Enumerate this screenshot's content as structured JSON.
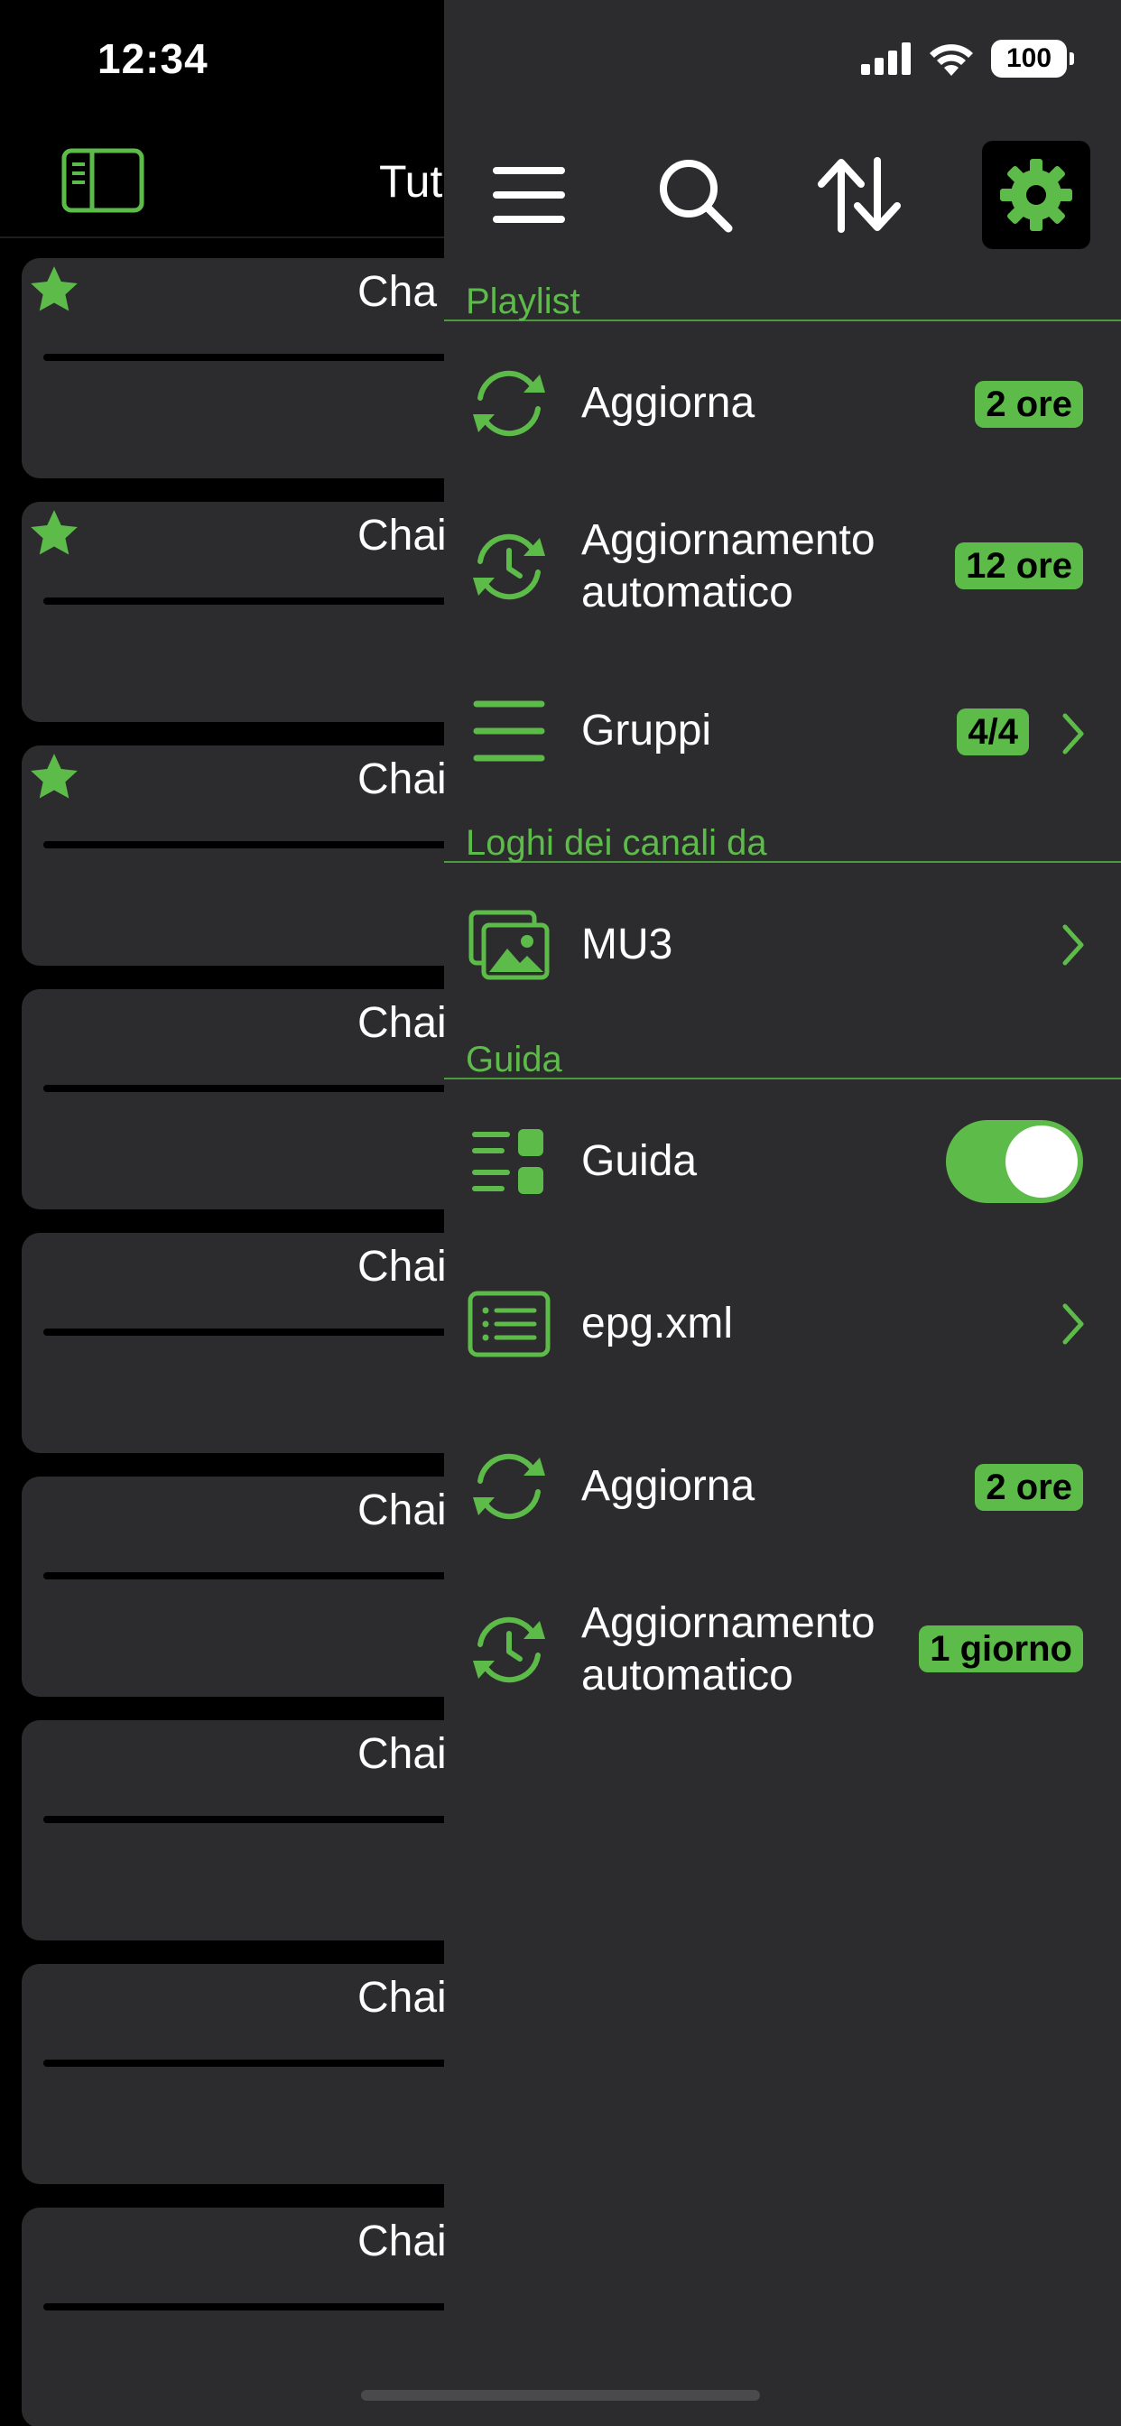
{
  "status_bar": {
    "time": "12:34",
    "battery": "100"
  },
  "background": {
    "header_title": "Tut",
    "channels": [
      {
        "name": "Cha",
        "favorite": true
      },
      {
        "name": "Chai",
        "favorite": true
      },
      {
        "name": "Chai",
        "favorite": true
      },
      {
        "name": "Chai",
        "favorite": false
      },
      {
        "name": "Chai",
        "favorite": false
      },
      {
        "name": "Chai",
        "favorite": false
      },
      {
        "name": "Chai",
        "favorite": false
      },
      {
        "name": "Chai",
        "favorite": false
      },
      {
        "name": "Chai",
        "favorite": false
      }
    ]
  },
  "drawer": {
    "toolbar": {
      "icons": [
        "menu-icon",
        "search-icon",
        "sort-icon",
        "gear-icon"
      ],
      "active": "gear-icon"
    },
    "sections": {
      "playlist": {
        "title": "Playlist",
        "refresh": {
          "label": "Aggiorna",
          "badge": "2 ore"
        },
        "auto_refresh": {
          "label_line1": "Aggiornamento",
          "label_line2": "automatico",
          "badge": "12 ore"
        },
        "groups": {
          "label": "Gruppi",
          "badge": "4/4"
        }
      },
      "logos": {
        "title": "Loghi dei canali da",
        "source": {
          "label": "MU3"
        }
      },
      "guide": {
        "title": "Guida",
        "toggle": {
          "label": "Guida",
          "enabled": true
        },
        "file": {
          "label": "epg.xml"
        },
        "refresh": {
          "label": "Aggiorna",
          "badge": "2 ore"
        },
        "auto_refresh": {
          "label_line1": "Aggiornamento",
          "label_line2": "automatico",
          "badge": "1 giorno"
        }
      }
    }
  },
  "colors": {
    "accent": "#5dbb4a",
    "drawer_bg": "#2c2c2e",
    "card_bg": "#2c2c2e",
    "background": "#000000"
  }
}
